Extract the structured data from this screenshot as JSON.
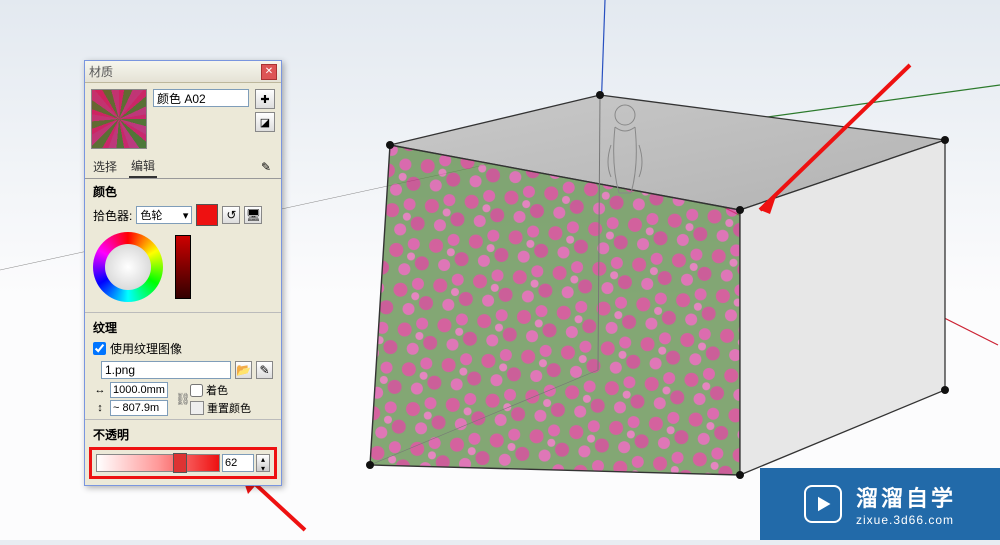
{
  "panel": {
    "title": "材质",
    "material_name": "颜色 A02",
    "tabs": {
      "select": "选择",
      "edit": "编辑"
    },
    "color_heading": "颜色",
    "picker_label": "拾色器:",
    "picker_value": "色轮",
    "texture_heading": "纹理",
    "use_texture_label": "使用纹理图像",
    "texture_file": "1.png",
    "width_value": "1000.0mm",
    "height_value": "~ 807.9m",
    "tint_label": "着色",
    "reset_color_label": "重置颜色",
    "opacity_heading": "不透明",
    "opacity_value": "62"
  },
  "icons": {
    "close": "✕",
    "create": "✚",
    "default": "◪",
    "dropper": "✎",
    "undo": "↺",
    "screen": "🖥",
    "browse": "📂",
    "link": "⛓",
    "harrow": "↔",
    "varrow": "↕",
    "up": "▴",
    "down": "▾",
    "dd": "▾"
  },
  "watermark": {
    "brand": "溜溜自学",
    "url": "zixue.3d66.com"
  }
}
